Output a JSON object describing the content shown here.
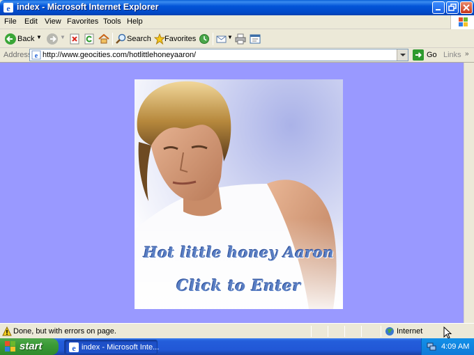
{
  "window": {
    "title": "index - Microsoft Internet Explorer"
  },
  "menu": [
    "File",
    "Edit",
    "View",
    "Favorites",
    "Tools",
    "Help"
  ],
  "toolbar": {
    "back_label": "Back",
    "search_label": "Search",
    "favorites_label": "Favorites"
  },
  "address": {
    "label": "Address",
    "url": "http://www.geocities.com/hotlittlehoneyaaron/",
    "go_label": "Go",
    "links_label": "Links"
  },
  "page": {
    "background_color": "#9999ff",
    "banner_line1": "Hot little honey Aaron",
    "banner_line2": "Click to Enter"
  },
  "status": {
    "text": "Done, but with errors on page.",
    "zone": "Internet"
  },
  "taskbar": {
    "start_label": "start",
    "task_label": "index - Microsoft Inte...",
    "clock": "4:09 AM"
  }
}
